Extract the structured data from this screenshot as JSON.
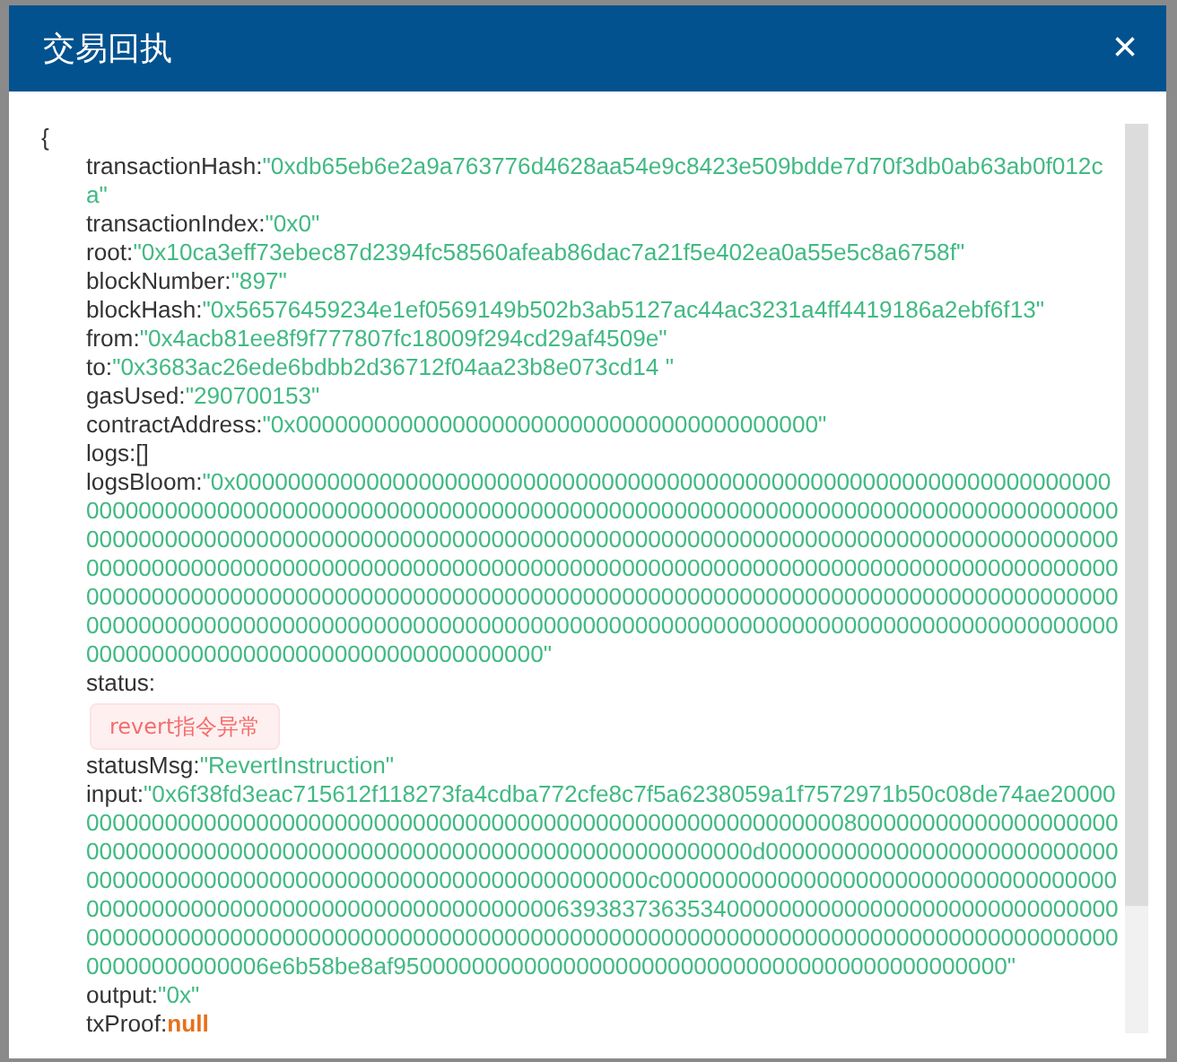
{
  "dialog": {
    "title": "交易回执",
    "close": "×"
  },
  "receipt": {
    "open_brace": "{",
    "fields": [
      {
        "key": "transactionHash:",
        "value": "\"0xdb65eb6e2a9a763776d4628aa54e9c8423e509bdde7d70f3db0ab63ab0f012ca\"",
        "kind": "string"
      },
      {
        "key": "transactionIndex:",
        "value": "\"0x0\"",
        "kind": "string"
      },
      {
        "key": "root:",
        "value": "\"0x10ca3eff73ebec87d2394fc58560afeab86dac7a21f5e402ea0a55e5c8a6758f\"",
        "kind": "string"
      },
      {
        "key": "blockNumber:",
        "value": "\"897\"",
        "kind": "string"
      },
      {
        "key": "blockHash:",
        "value": "\"0x56576459234e1ef0569149b502b3ab5127ac44ac3231a4ff4419186a2ebf6f13\"",
        "kind": "string"
      },
      {
        "key": "from:",
        "value": "\"0x4acb81ee8f9f777807fc18009f294cd29af4509e\"",
        "kind": "string"
      },
      {
        "key": "to:",
        "value": "\"0x3683ac26ede6bdbb2d36712f04aa23b8e073cd14 \"",
        "kind": "string"
      },
      {
        "key": "gasUsed:",
        "value": "\"290700153\"",
        "kind": "string"
      },
      {
        "key": "contractAddress:",
        "value": "\"0x0000000000000000000000000000000000000000\"",
        "kind": "string"
      },
      {
        "key": "logs:",
        "value": "[]",
        "kind": "raw"
      },
      {
        "key": "logsBloom:",
        "value": "\"0x00000000000000000000000000000000000000000000000000000000000000000000000000000000000000000000000000000000000000000000000000000000000000000000000000000000000000000000000000000000000000000000000000000000000000000000000000000000000000000000000000000000000000000000000000000000000000000000000000000000000000000000000000000000000000000000000000000000000000000000000000000000000000000000000000000000000000000000000000000000000000000000000000000000000000000000000000000000000000000000000000000000000000000\"",
        "kind": "string"
      },
      {
        "key": "status:",
        "value": "revert指令异常",
        "kind": "tag"
      },
      {
        "key": "statusMsg:",
        "value": "\"RevertInstruction\"",
        "kind": "string"
      },
      {
        "key": "input:",
        "value": "\"0x6f38fd3eac715612f118273fa4cdba772cfe8c7f5a6238059a1f7572971b50c08de74ae200000000000000000000000000000000000000000000000000000000000000800000000000000000000000000000000000000000000000000000000000000000000000d0000000000000000000000000000000000000000000000000000000000000000000000c000000000000000000000000000000000000000000000000000000000000000000000006393837363534000000000000000000000000000000000000000000000000000000000000000000000000000000000000000000000000000000000000000000000000006e6b58be8af95000000000000000000000000000000000000000000000\"",
        "kind": "string"
      },
      {
        "key": "output:",
        "value": "\"0x\"",
        "kind": "string"
      },
      {
        "key": "txProof:",
        "value": "null",
        "kind": "null"
      }
    ]
  }
}
